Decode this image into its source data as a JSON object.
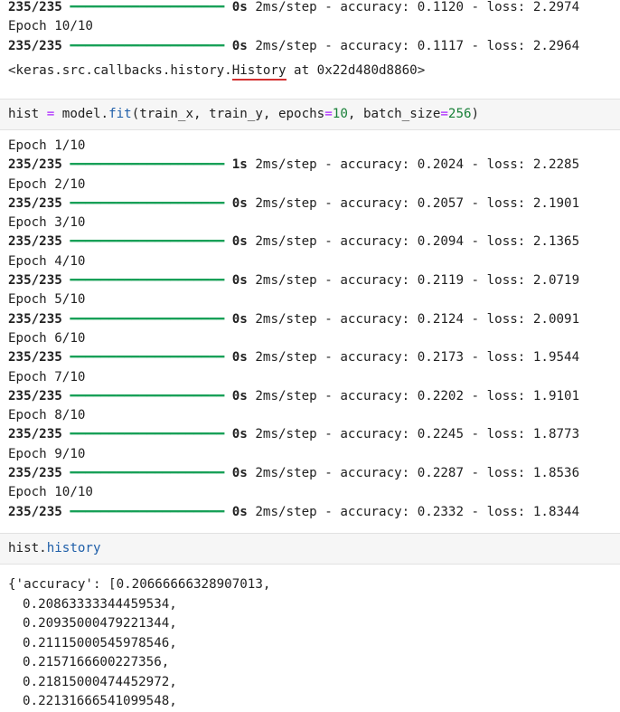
{
  "top_output": {
    "row1": {
      "steps": "235/235",
      "time": "0s",
      "rate": "2ms/step",
      "accuracy": "accuracy: 0.1120",
      "loss": "loss: 2.2974"
    },
    "epoch_label": "Epoch 10/10",
    "row2": {
      "steps": "235/235",
      "time": "0s",
      "rate": "2ms/step",
      "accuracy": "accuracy: 0.1117",
      "loss": "loss: 2.2964"
    },
    "history_repr_prefix": "<keras.src.callbacks.history.",
    "history_repr_class": "History",
    "history_repr_suffix": " at 0x22d480d8860>"
  },
  "cell1": {
    "var": "hist ",
    "eq": "=",
    "obj": " model.",
    "method": "fit",
    "args1": "(train_x, train_y, epochs",
    "eq2": "=",
    "epochs": "10",
    "args2": ", batch_size",
    "eq3": "=",
    "batch": "256",
    "close": ")"
  },
  "training": {
    "bar": "━━━━━━━━━━━━━━━━━━━━",
    "epochs": [
      {
        "label": "Epoch 1/10",
        "steps": "235/235",
        "time": "1s",
        "rate": "2ms/step",
        "accuracy": "accuracy: 0.2024",
        "loss": "loss: 2.2285"
      },
      {
        "label": "Epoch 2/10",
        "steps": "235/235",
        "time": "0s",
        "rate": "2ms/step",
        "accuracy": "accuracy: 0.2057",
        "loss": "loss: 2.1901"
      },
      {
        "label": "Epoch 3/10",
        "steps": "235/235",
        "time": "0s",
        "rate": "2ms/step",
        "accuracy": "accuracy: 0.2094",
        "loss": "loss: 2.1365"
      },
      {
        "label": "Epoch 4/10",
        "steps": "235/235",
        "time": "0s",
        "rate": "2ms/step",
        "accuracy": "accuracy: 0.2119",
        "loss": "loss: 2.0719"
      },
      {
        "label": "Epoch 5/10",
        "steps": "235/235",
        "time": "0s",
        "rate": "2ms/step",
        "accuracy": "accuracy: 0.2124",
        "loss": "loss: 2.0091"
      },
      {
        "label": "Epoch 6/10",
        "steps": "235/235",
        "time": "0s",
        "rate": "2ms/step",
        "accuracy": "accuracy: 0.2173",
        "loss": "loss: 1.9544"
      },
      {
        "label": "Epoch 7/10",
        "steps": "235/235",
        "time": "0s",
        "rate": "2ms/step",
        "accuracy": "accuracy: 0.2202",
        "loss": "loss: 1.9101"
      },
      {
        "label": "Epoch 8/10",
        "steps": "235/235",
        "time": "0s",
        "rate": "2ms/step",
        "accuracy": "accuracy: 0.2245",
        "loss": "loss: 1.8773"
      },
      {
        "label": "Epoch 9/10",
        "steps": "235/235",
        "time": "0s",
        "rate": "2ms/step",
        "accuracy": "accuracy: 0.2287",
        "loss": "loss: 1.8536"
      },
      {
        "label": "Epoch 10/10",
        "steps": "235/235",
        "time": "0s",
        "rate": "2ms/step",
        "accuracy": "accuracy: 0.2332",
        "loss": "loss: 1.8344"
      }
    ]
  },
  "cell2": {
    "obj": "hist.",
    "attr": "history"
  },
  "dict_output": {
    "first": "{'accuracy': [0.20666666328907013,",
    "values": [
      "0.20863333344459534,",
      "0.20935000479221344,",
      "0.21115000545978546,",
      "0.2157166600227356,",
      "0.21815000474452972,",
      "0.22131666541099548,"
    ]
  },
  "colors": {
    "progress_bar": "#18a058",
    "keyword": "#aa22ff",
    "method": "#1f5fa9",
    "number": "#188038",
    "underline": "#d32f2f"
  }
}
